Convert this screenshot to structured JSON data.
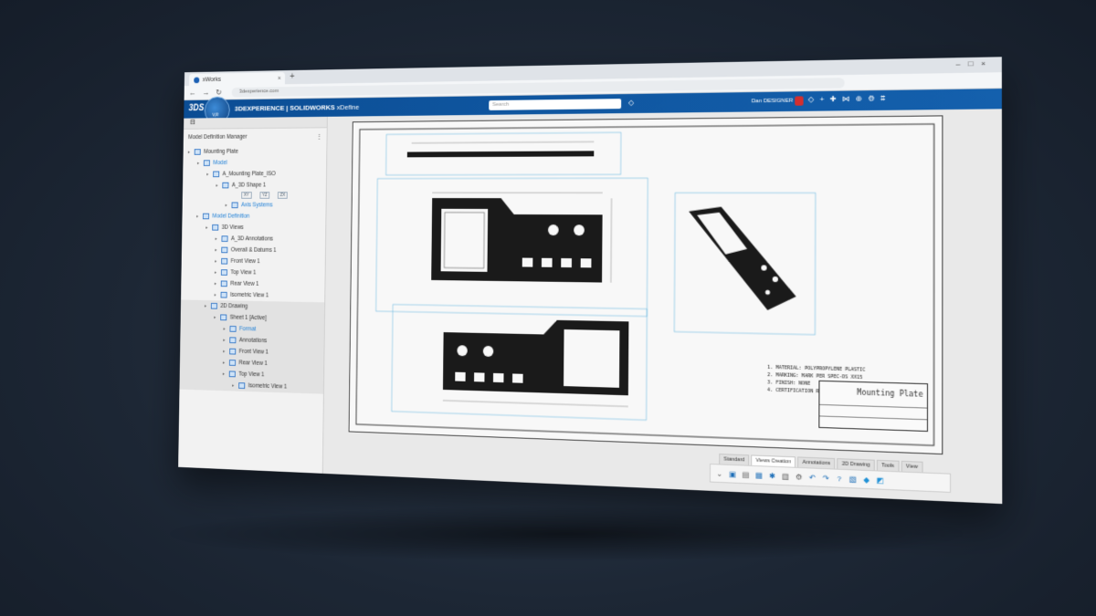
{
  "browser": {
    "tab_title": "xWorks",
    "tab_close": "×",
    "new_tab": "+",
    "window_controls": "–□×",
    "url": "3dexperience.com",
    "nav": {
      "back": "←",
      "forward": "→",
      "reload": "↻"
    }
  },
  "app_header": {
    "logo": "3DS",
    "compass_label": "V,R",
    "brand_bold": "3DEXPERIENCE | SOLIDWORKS",
    "brand_app": "xDefine",
    "search_placeholder": "Search",
    "user_name": "Dan DESIGNER"
  },
  "tree": {
    "panel_title": "Model Definition Manager",
    "menu_icon": "⋮",
    "nodes": [
      {
        "label": "Mounting Plate",
        "indent": 0
      },
      {
        "label": "Model",
        "indent": 1,
        "blue": true
      },
      {
        "label": "A_Mounting Plate_ISO",
        "indent": 2
      },
      {
        "label": "A_3D Shape 1",
        "indent": 3
      },
      {
        "label": "Axis Systems",
        "indent": 4,
        "blue": true
      },
      {
        "label": "Model Definition",
        "indent": 1,
        "blue": true
      },
      {
        "label": "3D Views",
        "indent": 2
      },
      {
        "label": "A_3D Annotations",
        "indent": 3
      },
      {
        "label": "Overall & Datums 1",
        "indent": 3
      },
      {
        "label": "Front View 1",
        "indent": 3
      },
      {
        "label": "Top View 1",
        "indent": 3
      },
      {
        "label": "Rear View 1",
        "indent": 3
      },
      {
        "label": "Isometric View 1",
        "indent": 3
      },
      {
        "label": "2D Drawing",
        "indent": 2,
        "grey": true
      },
      {
        "label": "Sheet 1 [Active]",
        "indent": 3,
        "grey": true
      },
      {
        "label": "Format",
        "indent": 4,
        "blue": true,
        "grey": true
      },
      {
        "label": "Annotations",
        "indent": 4,
        "grey": true
      },
      {
        "label": "Front View 1",
        "indent": 4,
        "grey": true
      },
      {
        "label": "Rear View 1",
        "indent": 4,
        "grey": true
      },
      {
        "label": "Top View 1",
        "indent": 4,
        "grey": true
      },
      {
        "label": "Isometric View 1",
        "indent": 5,
        "grey": true
      }
    ],
    "axis_buttons": [
      "XY",
      "YZ",
      "ZX"
    ]
  },
  "drawing": {
    "notes": [
      "1. MATERIAL: POLYPROPYLENE PLASTIC",
      "2. MARKING: MARK PER SPEC-DS XX15",
      "3. FINISH: NONE",
      "4. CERTIFICATION REQUIRED"
    ],
    "title_block_title": "Mounting Plate"
  },
  "bottom_tabs": [
    "Standard",
    "Views Creation",
    "Annotations",
    "2D Drawing",
    "Tools",
    "View"
  ],
  "active_tab": "Views Creation",
  "toolbar_icons": [
    "chevron-down",
    "new-view",
    "sheet",
    "save",
    "settings-star",
    "print",
    "gear",
    "undo",
    "redo",
    "help",
    "views",
    "cube",
    "display"
  ]
}
